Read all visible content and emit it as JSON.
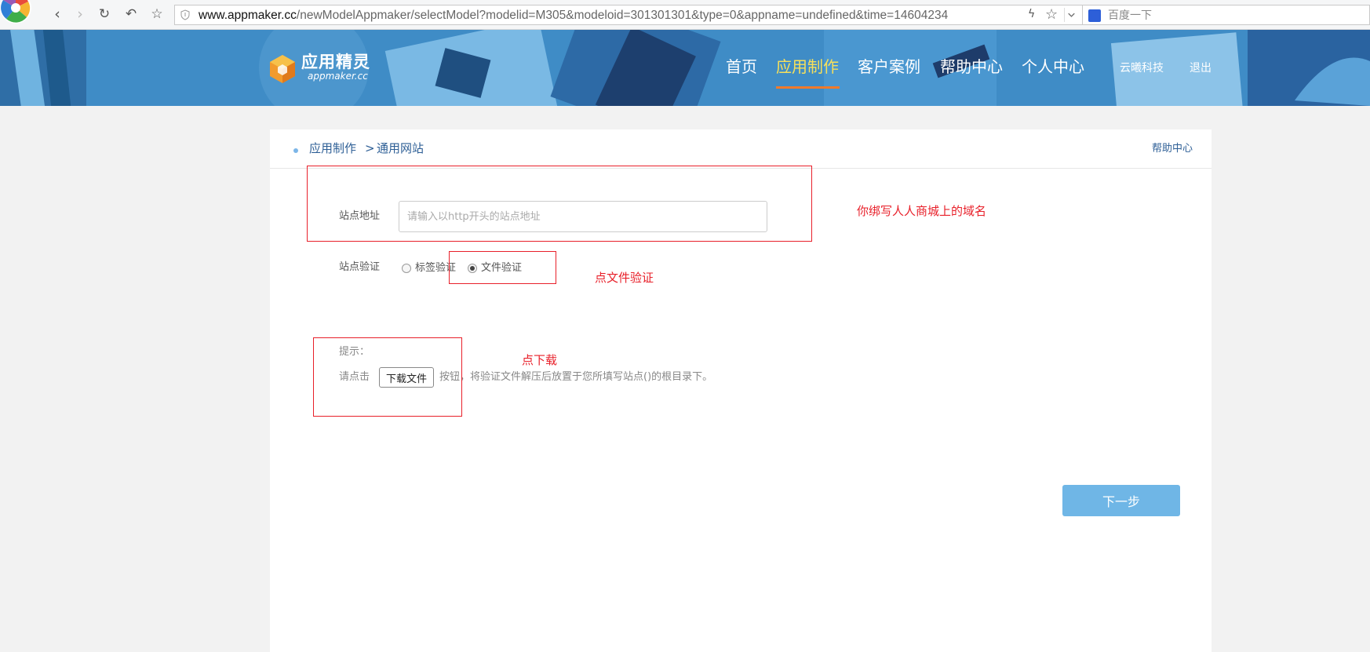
{
  "browser": {
    "url_host": "www.appmaker.cc",
    "url_path": "/newModelAppmaker/selectModel?modelid=M305&modeloid=301301301&type=0&appname=undefined&time=14604234",
    "search_placeholder": "百度一下",
    "icons": [
      "browser-logo-icon",
      "back-icon",
      "forward-icon",
      "reload-icon",
      "undo-icon",
      "star-icon",
      "shield-icon",
      "flash-icon",
      "chevron-down-icon",
      "baidu-icon"
    ]
  },
  "header": {
    "logo_name": "应用精灵",
    "logo_sub": "appmaker.cc",
    "nav": [
      {
        "label": "首页",
        "active": false
      },
      {
        "label": "应用制作",
        "active": true
      },
      {
        "label": "客户案例",
        "active": false
      },
      {
        "label": "帮助中心",
        "active": false
      },
      {
        "label": "个人中心",
        "active": false
      }
    ],
    "company_link": "云曦科技",
    "logout_link": "退出",
    "active_color": "#f7e05a",
    "underline_color": "#f07a2a"
  },
  "breadcrumb": {
    "section": "应用制作",
    "separator": ">",
    "current": "通用网站",
    "help_link": "帮助中心"
  },
  "form": {
    "site_url_label": "站点地址",
    "site_url_placeholder": "请输入以http开头的站点地址",
    "site_url_value": "",
    "verify_label": "站点验证",
    "verify_options": [
      {
        "label": "标签验证",
        "checked": false
      },
      {
        "label": "文件验证",
        "checked": true
      }
    ]
  },
  "tip": {
    "title": "提示：",
    "prefix": "请点击",
    "button_label": "下载文件",
    "suffix": "按钮，将验证文件解压后放置于您所填写站点()的根目录下。"
  },
  "next_button": "下一步",
  "annotations": {
    "domain_note": "你绑写人人商城上的域名",
    "file_verify_note": "点文件验证",
    "download_note": "点下载",
    "color": "#e8202a"
  }
}
